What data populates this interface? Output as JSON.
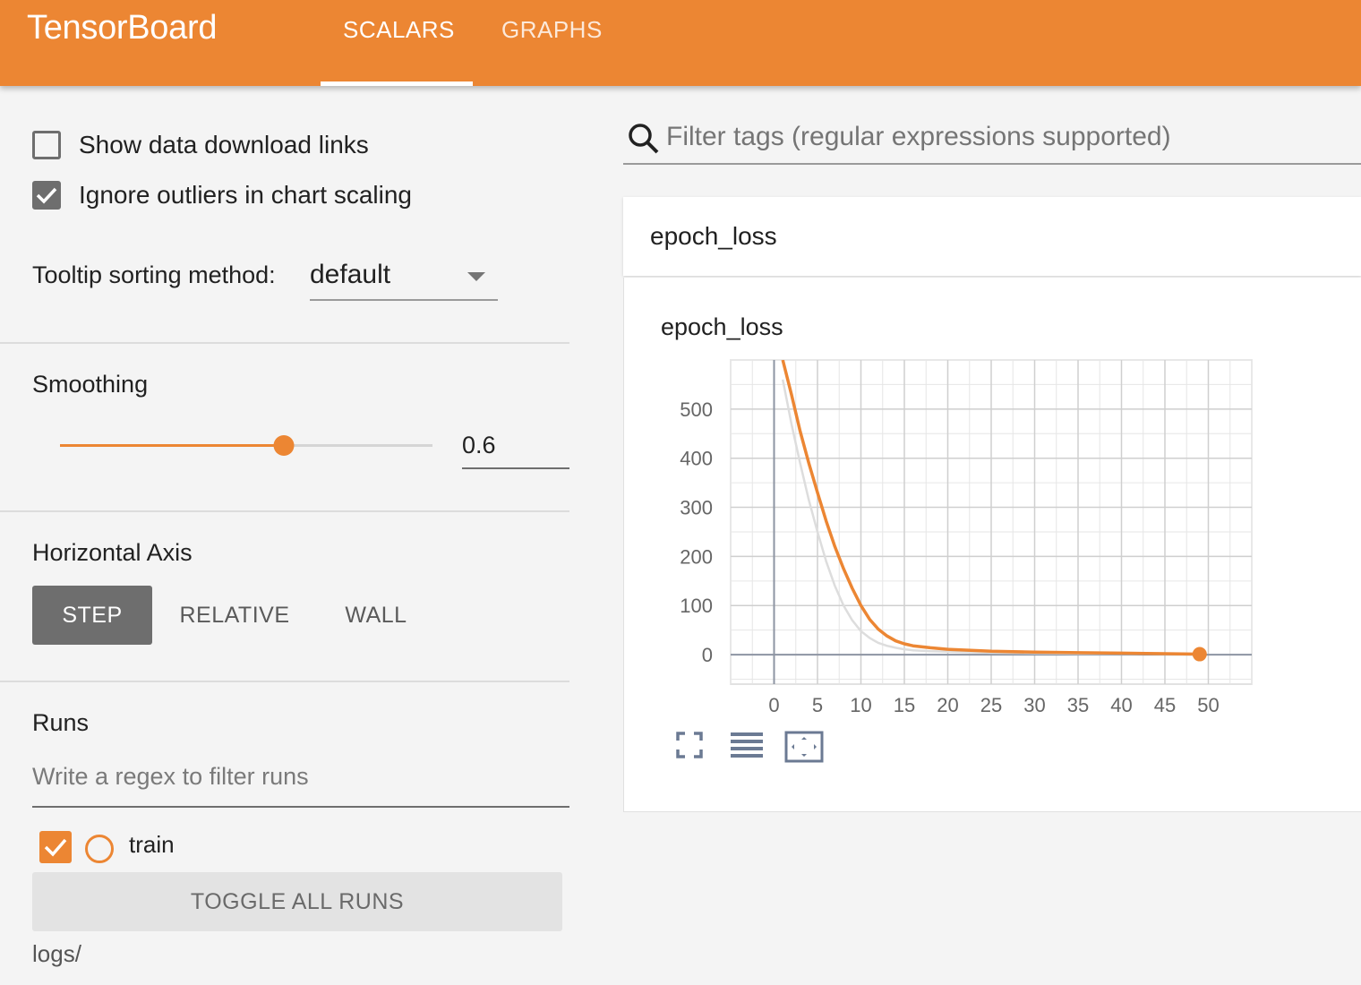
{
  "header": {
    "brand": "TensorBoard",
    "tabs": [
      {
        "label": "SCALARS",
        "active": true
      },
      {
        "label": "GRAPHS",
        "active": false
      }
    ]
  },
  "sidebar": {
    "show_download_links": {
      "label": "Show data download links",
      "checked": false
    },
    "ignore_outliers": {
      "label": "Ignore outliers in chart scaling",
      "checked": true
    },
    "tooltip_sorting": {
      "label": "Tooltip sorting method:",
      "value": "default"
    },
    "smoothing": {
      "title": "Smoothing",
      "value": "0.6",
      "fraction": 0.6
    },
    "horizontal_axis": {
      "title": "Horizontal Axis",
      "options": [
        {
          "label": "STEP",
          "active": true
        },
        {
          "label": "RELATIVE",
          "active": false
        },
        {
          "label": "WALL",
          "active": false
        }
      ]
    },
    "runs": {
      "title": "Runs",
      "filter_placeholder": "Write a regex to filter runs",
      "items": [
        {
          "label": "train",
          "checked": true,
          "color": "#ec8633"
        }
      ],
      "toggle_label": "TOGGLE ALL RUNS",
      "logdir": "logs/"
    }
  },
  "main": {
    "search_placeholder": "Filter tags (regular expressions supported)",
    "card": {
      "header_title": "epoch_loss",
      "chart_title": "epoch_loss"
    },
    "tools": [
      "fullscreen-icon",
      "log-scale-icon",
      "fit-domain-icon"
    ]
  },
  "accent_color": "#ec8633",
  "chart_data": {
    "type": "line",
    "title": "epoch_loss",
    "xlabel": "",
    "ylabel": "",
    "xlim": [
      -5,
      55
    ],
    "ylim": [
      -60,
      600
    ],
    "x_ticks": [
      0,
      5,
      10,
      15,
      20,
      25,
      30,
      35,
      40,
      45,
      50
    ],
    "y_ticks": [
      0,
      100,
      200,
      300,
      400,
      500
    ],
    "grid": true,
    "series": [
      {
        "name": "train",
        "kind": "smoothed",
        "color": "#ec8633",
        "x": [
          1,
          2,
          3,
          4,
          5,
          6,
          7,
          8,
          9,
          10,
          11,
          12,
          13,
          14,
          15,
          16,
          18,
          20,
          25,
          30,
          35,
          40,
          45,
          49
        ],
        "y": [
          600,
          530,
          455,
          390,
          330,
          272,
          220,
          175,
          135,
          100,
          72,
          52,
          38,
          28,
          22,
          18,
          14,
          11,
          7,
          5,
          4,
          3,
          2,
          1
        ]
      },
      {
        "kind": "raw",
        "color": "#dddddd",
        "x": [
          1,
          2,
          3,
          4,
          5,
          6,
          7,
          8,
          9,
          10,
          11,
          12,
          13,
          14,
          15,
          16,
          18,
          20,
          25,
          30,
          35,
          40,
          45,
          49
        ],
        "y": [
          560,
          470,
          390,
          315,
          250,
          190,
          140,
          100,
          70,
          48,
          34,
          24,
          18,
          14,
          11,
          9,
          7,
          6,
          4,
          3,
          2,
          2,
          1,
          1
        ]
      }
    ]
  }
}
